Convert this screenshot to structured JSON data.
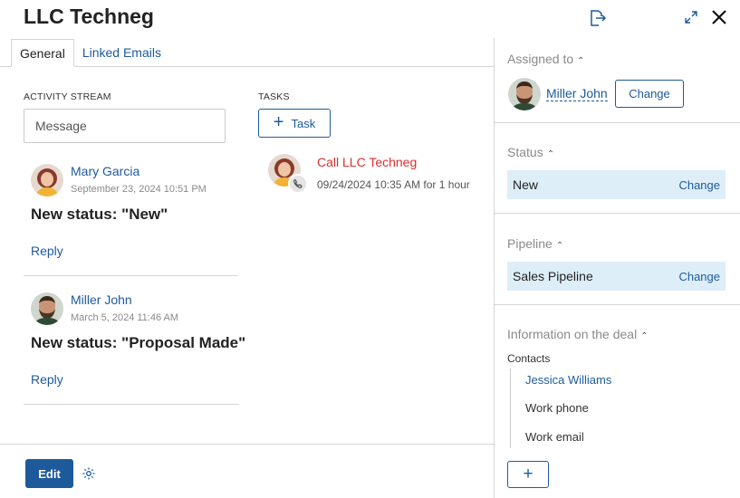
{
  "header": {
    "title": "LLC Techneg",
    "icons": [
      "export-icon",
      "expand-icon",
      "close-icon"
    ]
  },
  "tabs": [
    {
      "label": "General",
      "active": true
    },
    {
      "label": "Linked Emails",
      "active": false
    }
  ],
  "activity_stream": {
    "label": "ACTIVITY STREAM",
    "message_placeholder": "Message",
    "entries": [
      {
        "author": "Mary Garcia",
        "date": "September 23, 2024 10:51 PM",
        "text": "New status: \"New\"",
        "reply_label": "Reply"
      },
      {
        "author": "Miller John",
        "date": "March 5, 2024 11:46 AM",
        "text": "New status: \"Proposal Made\"",
        "reply_label": "Reply"
      }
    ]
  },
  "tasks": {
    "label": "TASKS",
    "add_button_label": "Task",
    "items": [
      {
        "title": "Call LLC Techneg",
        "meta": "09/24/2024 10:35 AM for 1 hour"
      }
    ]
  },
  "footer": {
    "edit_label": "Edit"
  },
  "sidebar": {
    "assigned": {
      "heading": "Assigned to",
      "name": "Miller John",
      "change_label": "Change"
    },
    "status": {
      "heading": "Status",
      "value": "New",
      "change_label": "Change"
    },
    "pipeline": {
      "heading": "Pipeline",
      "value": "Sales Pipeline",
      "change_label": "Change"
    },
    "deal_info": {
      "heading": "Information on the deal",
      "contacts_label": "Contacts",
      "contact_name": "Jessica Williams",
      "work_phone": "Work phone",
      "work_email": "Work email",
      "add_label": "+"
    }
  },
  "colors": {
    "accent": "#1d5a9c",
    "task_red": "#d93030",
    "value_bg": "#deeef8"
  }
}
